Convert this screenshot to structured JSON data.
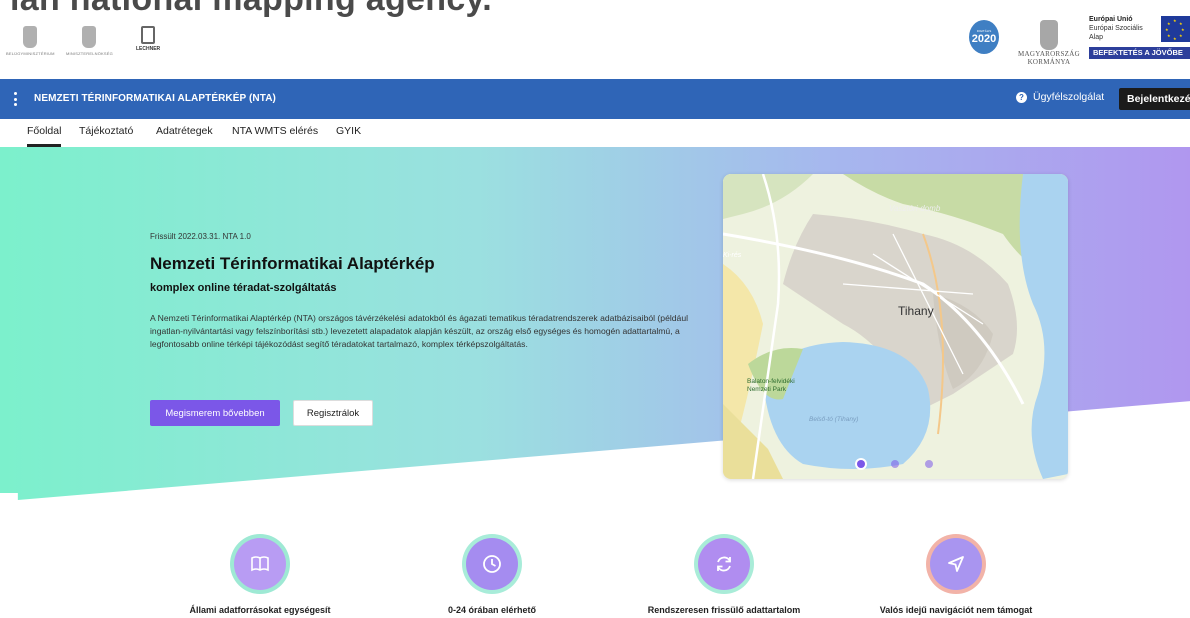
{
  "caption": "ian national mapping agency.",
  "logos": {
    "small1": "BELÜGYMINISZTÉRIUM",
    "small2": "MINISZTERELNÖKSÉG",
    "lechner": "LECHNER",
    "badge_top": "DIGITÁLIS",
    "badge_year": "2020",
    "gov_line1": "MAGYARORSZÁG",
    "gov_line2": "KORMÁNYA",
    "eu_line1": "Európai Unió",
    "eu_line2": "Európai Szociális",
    "eu_line3": "Alap",
    "eu_banner": "BEFEKTETÉS A JÖVŐBE"
  },
  "appbar": {
    "title": "NEMZETI TÉRINFORMATIKAI ALAPTÉRKÉP (NTA)",
    "help_label": "Ügyfélszolgálat",
    "login_label": "Bejelentkezés"
  },
  "tabs": [
    "Főoldal",
    "Tájékoztató",
    "Adatrétegek",
    "NTA WMTS elérés",
    "GYIK"
  ],
  "hero": {
    "meta": "Frissült 2022.03.31.  NTA 1.0",
    "title": "Nemzeti Térinformatikai Alaptérkép",
    "subtitle": "komplex online téradat-szolgáltatás",
    "description": "A Nemzeti Térinformatikai Alaptérkép (NTA) országos távérzékelési adatokból és ágazati tematikus téradatrendszerek adatbázisaiból (például ingatlan-nyilvántartási vagy felszínborítási stb.) levezetett alapadatok alapján készült, az ország első egységes és homogén adattartalmú, a legfontosabb online térképi tájékozódást segítő téradatokat tartalmazó, komplex térképszolgáltatás.",
    "primary_button": "Megismerem bővebben",
    "secondary_button": "Regisztrálok"
  },
  "map": {
    "label_hill": "Vasztóri-domb",
    "label_ki": "Ki-rés",
    "label_town": "Tihany",
    "label_park": "Balaton-felvidéki Nemzeti Park",
    "label_lake": "Belső-tó (Tihany)",
    "slide_count": 3,
    "active_slide": 1
  },
  "features": [
    {
      "label": "Állami adatforrásokat egységesít",
      "icon": "book-icon",
      "color": "#b89cf3",
      "ring": "#9ee9d4"
    },
    {
      "label": "0-24 órában elérhető",
      "icon": "clock-icon",
      "color": "#a58cf0",
      "ring": "#a8ecd9"
    },
    {
      "label": "Rendszeresen frissülő adattartalom",
      "icon": "refresh-icon",
      "color": "#b08df0",
      "ring": "#a9ecd8"
    },
    {
      "label": "Valós idejű navigációt nem támogat",
      "icon": "navigation-icon",
      "color": "#a995f0",
      "ring": "#f2b3a8"
    }
  ]
}
